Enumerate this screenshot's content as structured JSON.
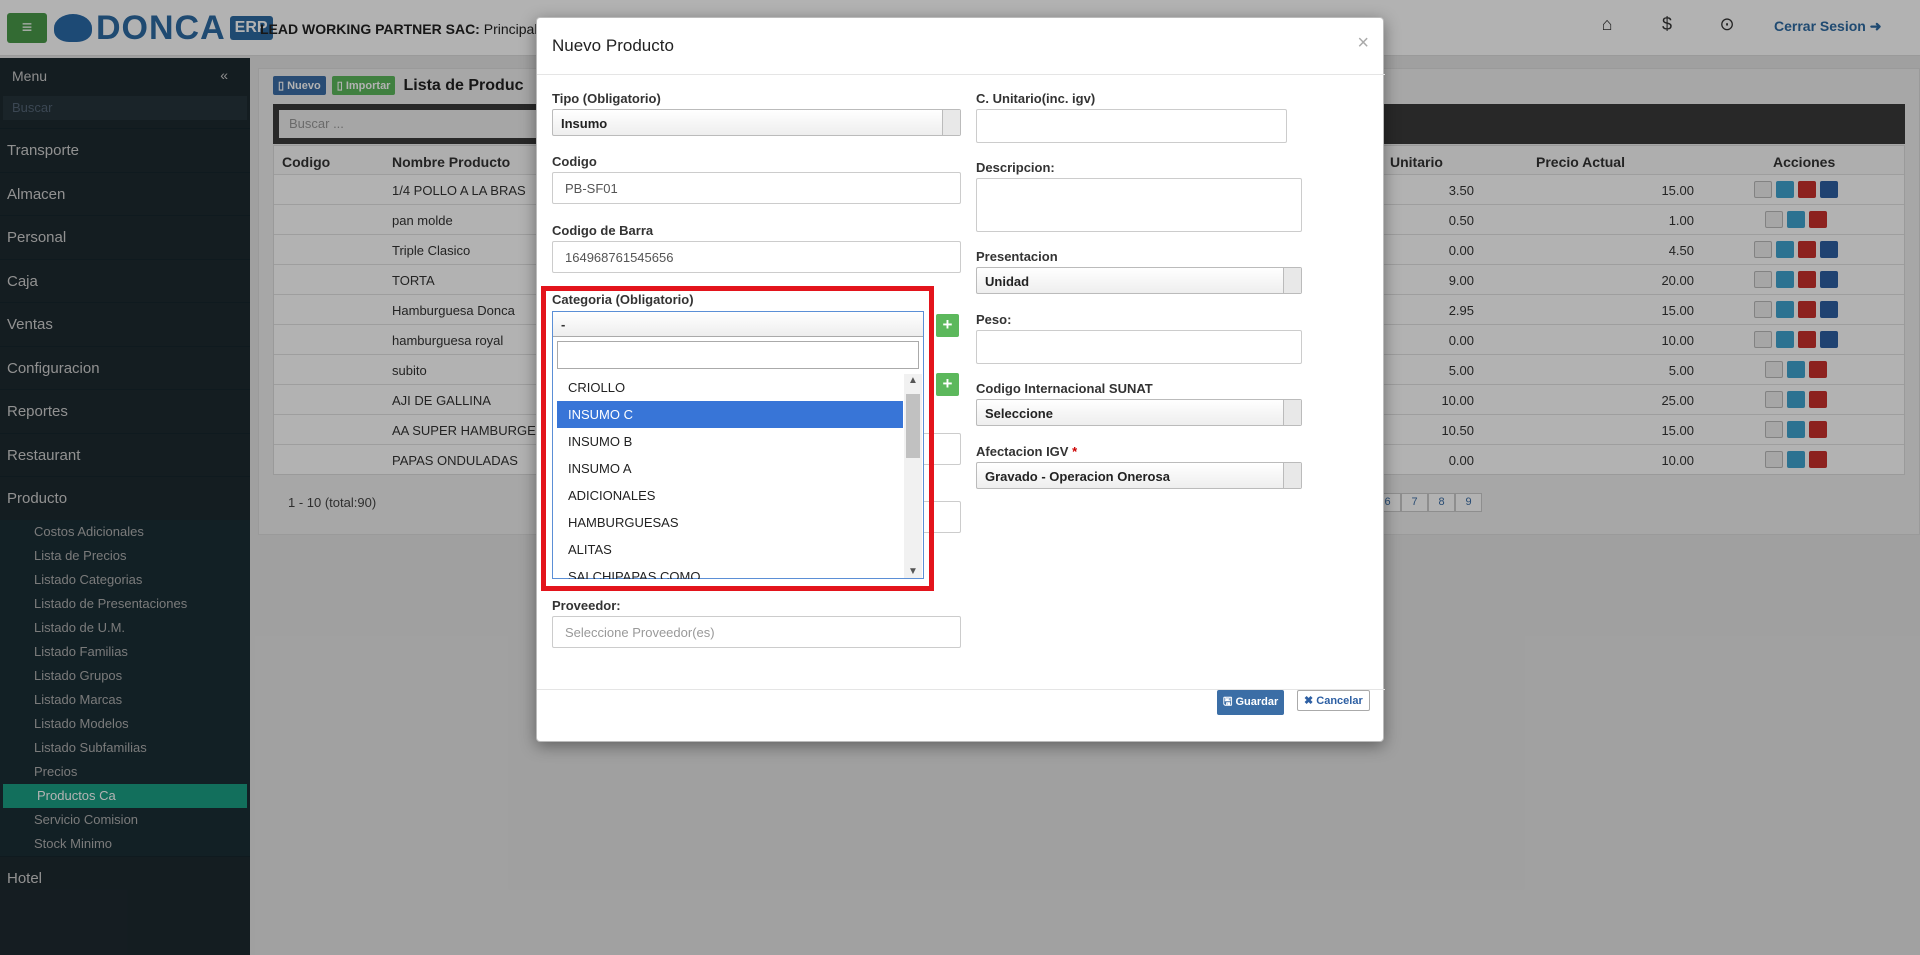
{
  "topbar": {
    "menu_icon": "hamburger-icon",
    "brand": "DONCA",
    "brand_suffix": "ERP",
    "company_bold": "LEAD WORKING PARTNER SAC:",
    "company_branch": "Principal",
    "icons": [
      "home-icon",
      "dollar-icon",
      "lock-icon"
    ],
    "logout_label": "Cerrar Sesion"
  },
  "sidebar": {
    "title": "Menu",
    "search_placeholder": "Buscar",
    "items": [
      "Transporte",
      "Almacen",
      "Personal",
      "Caja",
      "Ventas",
      "Configuracion",
      "Reportes",
      "Restaurant",
      "Producto"
    ],
    "sub_items": [
      "Costos Adicionales",
      "Lista de Precios",
      "Listado Categorias",
      "Listado de Presentaciones",
      "Listado de U.M.",
      "Listado Familias",
      "Listado Grupos",
      "Listado Marcas",
      "Listado Modelos",
      "Listado Subfamilias",
      "Precios",
      "Productos Ca",
      "Servicio Comision",
      "Stock Minimo"
    ],
    "active_sub": "Productos Ca",
    "last_item": "Hotel"
  },
  "page": {
    "btn_nuevo": "Nuevo",
    "btn_importar": "Importar",
    "title": "Lista de Produc",
    "search_placeholder": "Buscar ...",
    "columns": {
      "codigo": "Codigo",
      "nombre": "Nombre Producto",
      "unitario": "Unitario",
      "precio": "Precio Actual",
      "acciones": "Acciones"
    },
    "rows": [
      {
        "nombre": "1/4 POLLO A LA BRAS",
        "unitario": "3.50",
        "precio": "15.00"
      },
      {
        "nombre": "pan molde",
        "unitario": "0.50",
        "precio": "1.00"
      },
      {
        "nombre": "Triple Clasico",
        "unitario": "0.00",
        "precio": "4.50"
      },
      {
        "nombre": "TORTA",
        "unitario": "9.00",
        "precio": "20.00"
      },
      {
        "nombre": "Hamburguesa Donca",
        "unitario": "2.95",
        "precio": "15.00"
      },
      {
        "nombre": "hamburguesa royal",
        "unitario": "0.00",
        "precio": "10.00"
      },
      {
        "nombre": "subito",
        "unitario": "5.00",
        "precio": "5.00"
      },
      {
        "nombre": "AJI DE GALLINA",
        "unitario": "10.00",
        "precio": "25.00"
      },
      {
        "nombre": "AA SUPER HAMBURGE",
        "unitario": "10.50",
        "precio": "15.00"
      },
      {
        "nombre": "PAPAS ONDULADAS",
        "unitario": "0.00",
        "precio": "10.00"
      }
    ],
    "pager_info": "1 - 10 (total:90)",
    "pages": [
      "6",
      "7",
      "8",
      "9"
    ]
  },
  "modal": {
    "title": "Nuevo Producto",
    "close": "×",
    "tipo_label": "Tipo (Obligatorio)",
    "tipo_value": "Insumo",
    "codigo_label": "Codigo",
    "codigo_value": "PB-SF01",
    "barra_label": "Codigo de Barra",
    "barra_value": "164968761545656",
    "categoria_label": "Categoria (Obligatorio)",
    "categoria_value": "-",
    "categoria_options": [
      "CRIOLLO",
      "INSUMO C",
      "INSUMO B",
      "INSUMO A",
      "ADICIONALES",
      "HAMBURGUESAS",
      "ALITAS",
      "SALCHIPAPAS COMO"
    ],
    "categoria_highlight": "INSUMO C",
    "proveedor_label": "Proveedor:",
    "proveedor_placeholder": "Seleccione Proveedor(es)",
    "cunitario_label": "C. Unitario(inc. igv)",
    "descripcion_label": "Descripcion:",
    "presentacion_label": "Presentacion",
    "presentacion_value": "Unidad",
    "peso_label": "Peso:",
    "sunat_label": "Codigo Internacional SUNAT",
    "sunat_value": "Seleccione",
    "igv_label": "Afectacion IGV",
    "igv_required": "*",
    "igv_value": "Gravado - Operacion Onerosa",
    "plus": "+",
    "guardar": "Guardar",
    "cancelar": "Cancelar"
  }
}
